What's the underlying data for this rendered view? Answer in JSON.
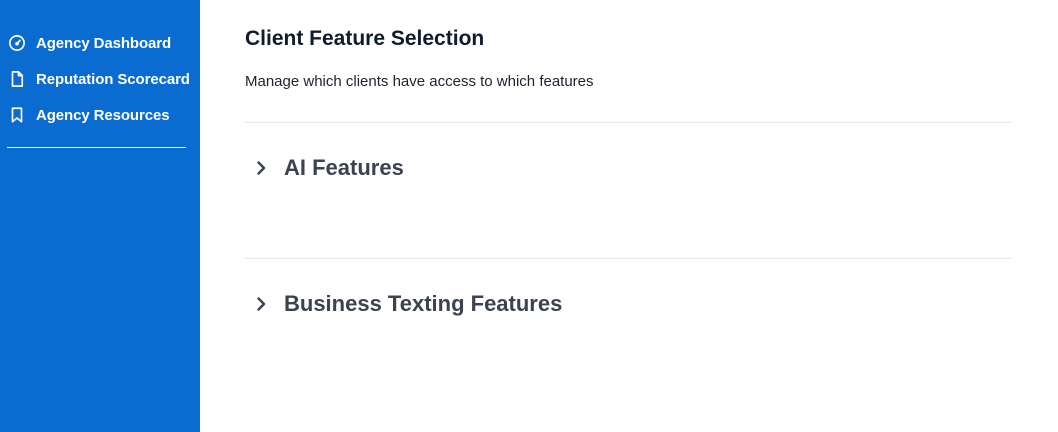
{
  "sidebar": {
    "items": [
      {
        "label": "Agency Dashboard",
        "icon": "gauge-icon"
      },
      {
        "label": "Reputation Scorecard",
        "icon": "document-icon"
      },
      {
        "label": "Agency Resources",
        "icon": "bookmark-icon"
      }
    ],
    "background": "#0a6bd1"
  },
  "main": {
    "title": "Client Feature Selection",
    "subtitle": "Manage which clients have access to which features",
    "sections": [
      {
        "title": "AI Features",
        "expanded": false
      },
      {
        "title": "Business Texting Features",
        "expanded": false
      }
    ]
  }
}
